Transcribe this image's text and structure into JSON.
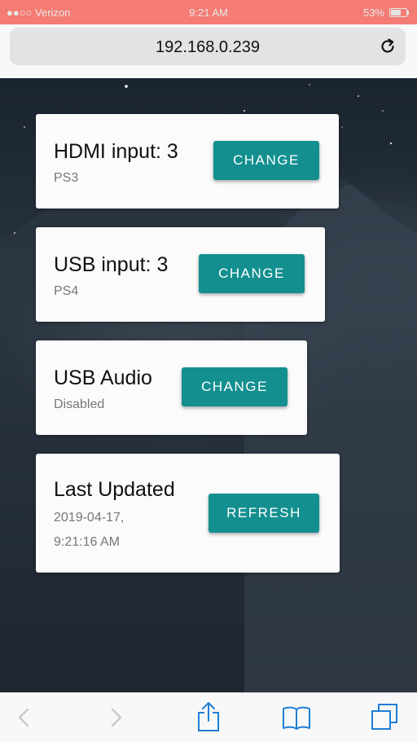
{
  "status_bar": {
    "carrier": "●●○○ Verizon",
    "time": "9:21 AM",
    "battery": "53%"
  },
  "browser": {
    "url": "192.168.0.239"
  },
  "cards": [
    {
      "title": "HDMI input: 3",
      "subtitle": "PS3",
      "button": "CHANGE"
    },
    {
      "title": "USB input: 3",
      "subtitle": "PS4",
      "button": "CHANGE"
    },
    {
      "title": "USB Audio",
      "subtitle": "Disabled",
      "button": "CHANGE"
    },
    {
      "title": "Last Updated",
      "subtitle_line1": "2019-04-17,",
      "subtitle_line2": "9:21:16 AM",
      "button": "REFRESH"
    }
  ],
  "colors": {
    "accent": "#138f8f",
    "status_bar": "#f47c74"
  },
  "icons": {
    "toolbar": [
      "back-icon",
      "forward-icon",
      "share-icon",
      "bookmarks-icon",
      "tabs-icon"
    ],
    "reload": "reload-icon"
  }
}
